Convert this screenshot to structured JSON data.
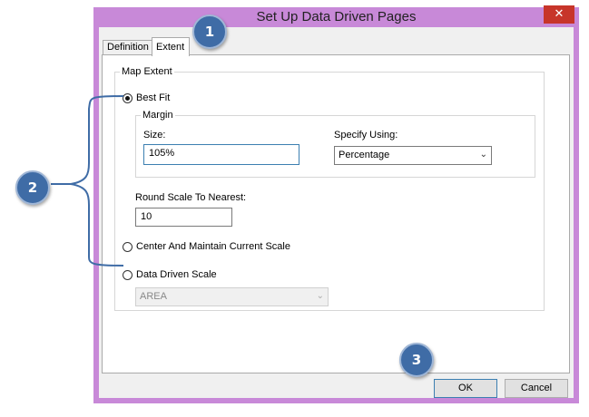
{
  "dialog": {
    "title": "Set Up Data Driven Pages",
    "close_glyph": "✕"
  },
  "tabs": [
    {
      "label": "Definition",
      "active": false
    },
    {
      "label": "Extent",
      "active": true
    }
  ],
  "map_extent": {
    "legend": "Map Extent",
    "best_fit": {
      "label": "Best Fit",
      "selected": true,
      "margin_legend": "Margin",
      "size_label": "Size:",
      "size_value": "105%",
      "specify_using_label": "Specify Using:",
      "specify_using_value": "Percentage",
      "round_scale_label": "Round Scale To Nearest:",
      "round_scale_value": "10"
    },
    "center_maintain": {
      "label": "Center And Maintain Current Scale",
      "selected": false
    },
    "data_driven_scale": {
      "label": "Data Driven Scale",
      "selected": false,
      "field_value": "AREA"
    }
  },
  "buttons": {
    "ok": "OK",
    "cancel": "Cancel"
  },
  "callouts": [
    "1",
    "2",
    "3"
  ],
  "colors": {
    "window_border": "#c889d8",
    "close_button": "#c7352a",
    "callout_fill": "#3f6ca6",
    "bracket": "#3f6ca6"
  },
  "icons": {
    "close": "close-icon",
    "dropdown": "chevron-down-icon"
  }
}
